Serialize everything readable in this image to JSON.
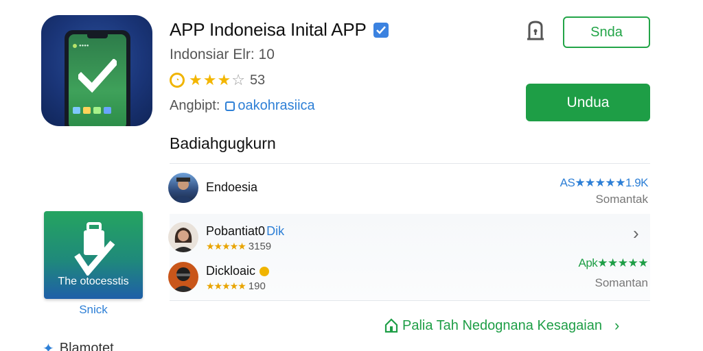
{
  "app": {
    "title": "APP Indoneisa Inital APP",
    "subtitle": "Indonsiar Elr: 10",
    "rating_count": "53",
    "rating": 3,
    "rating_max": 5,
    "developer_label": "Angbipt:",
    "developer_link": "oakohrasiica"
  },
  "actions": {
    "secondary_label": "Snda",
    "install_label": "Undua"
  },
  "section": {
    "title": "Badiahgugkurn"
  },
  "reviews": [
    {
      "name": "Endoesia",
      "stars_text": "",
      "count": "",
      "right_stat": "AS★★★★★1.9K",
      "right_sub": "Somantak",
      "right_stat_color": "#2d7fd6"
    },
    {
      "name": "Pobantiat0",
      "name_suffix": "Dik",
      "stars_text": "★★★★★",
      "count": "3159"
    },
    {
      "name": "Dickloaic",
      "stars_text": "★★★★★",
      "count": "190",
      "right_stat": "Apk★★★★★",
      "right_sub": "Somantan",
      "right_stat_color": "#1e9e46"
    }
  ],
  "promo": {
    "text": "The otocesstis",
    "caption": "Snick"
  },
  "more_link": "Palia Tah Nedognana Kesagaian",
  "bottom": {
    "label": "Blamotet"
  },
  "colors": {
    "brand_green": "#1e9e46",
    "link_blue": "#2d7fd6",
    "star_gold": "#f3b600"
  }
}
